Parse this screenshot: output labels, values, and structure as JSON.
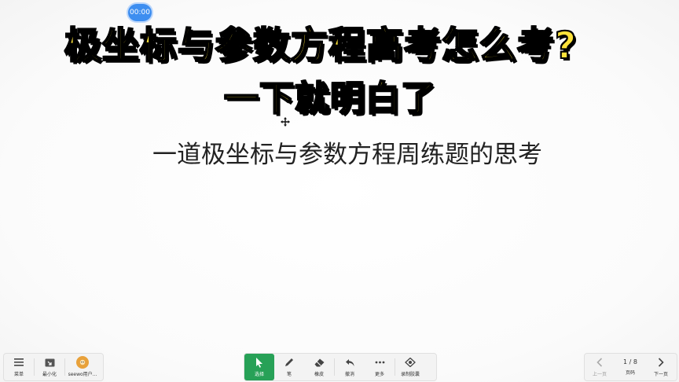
{
  "timer": {
    "label": "00:00"
  },
  "video_title": {
    "line1": "极坐标与参数方程高考怎么考?",
    "line2": "一下就明白了"
  },
  "slide": {
    "subtitle": "一道极坐标与参数方程周练题的思考"
  },
  "left_toolbar": {
    "menu_label": "菜单",
    "minimize_label": "最小化",
    "user_label": "seewo用户..."
  },
  "mid_toolbar": {
    "select_label": "选择",
    "pen_label": "笔",
    "eraser_label": "橡皮",
    "undo_label": "撤消",
    "more_label": "更多",
    "record_label": "录制胶囊"
  },
  "right_toolbar": {
    "prev_label": "上一页",
    "page_indicator": "1 / 8",
    "page_label": "页码",
    "next_label": "下一页"
  },
  "colors": {
    "title_fill": "#fde23a",
    "title_stroke": "#000000",
    "active_tool": "#27a157",
    "timer": "#3d8ef0"
  }
}
